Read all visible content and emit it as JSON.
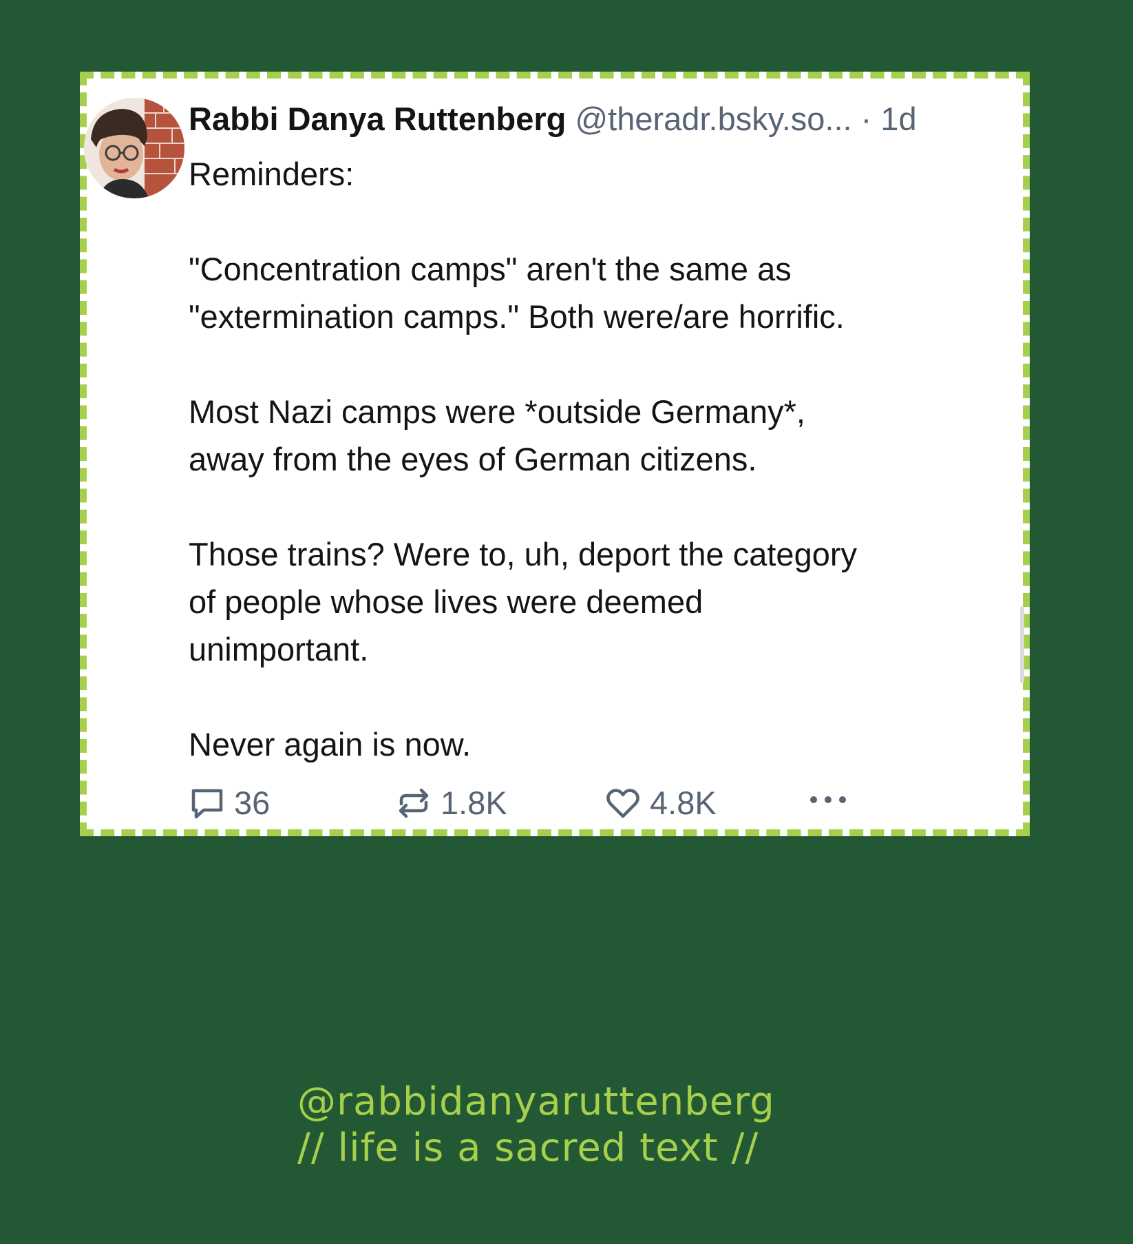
{
  "post": {
    "author_name": "Rabbi Danya Ruttenberg",
    "handle": "@theradr.bsky.so...",
    "time": "· 1d",
    "text": "Reminders:\n\n\"Concentration camps\" aren't the same as\n\"extermination camps.\" Both were/are horrific.\n\nMost Nazi camps were *outside Germany*,\naway from the eyes of German citizens.\n\nThose trains? Were to, uh, deport the category\nof people whose lives were deemed\nunimportant.\n\nNever again is now.",
    "actions": {
      "reply": {
        "icon": "speech-bubble-icon",
        "count": "36"
      },
      "repost": {
        "icon": "repost-icon",
        "count": "1.8K"
      },
      "like": {
        "icon": "heart-icon",
        "count": "4.8K"
      },
      "more": {
        "icon": "ellipsis-icon"
      }
    }
  },
  "footer": {
    "handle": "@rabbidanyaruttenberg",
    "tagline": "// life is a sacred text //"
  },
  "colors": {
    "background": "#225834",
    "accent": "#a6cf4e",
    "card": "#ffffff",
    "muted_text": "#566475"
  }
}
